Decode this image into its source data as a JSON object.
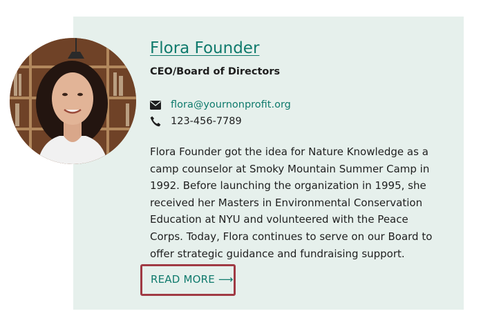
{
  "profile": {
    "name": "Flora Founder",
    "role": "CEO/Board of Directors",
    "email": "flora@yournonprofit.org",
    "phone": "123-456-7789",
    "bio_lines": [
      "Flora Founder got the idea for Nature Knowledge as a",
      "camp counselor at Smoky Mountain Summer Camp in",
      "1992. Before launching the organization in 1995, she",
      "received her Masters in Environmental Conservation",
      "Education at NYU and volunteered with the Peace",
      "Corps. Today, Flora continues to serve on our Board to",
      "offer strategic guidance and fundraising support."
    ],
    "read_more_label": "READ MORE",
    "read_more_arrow": "⟶"
  },
  "icons": {
    "email": "envelope-icon",
    "phone": "phone-icon"
  },
  "colors": {
    "card_background": "#e6f0ec",
    "link": "#0f7a6c",
    "highlight_border": "#a03a44",
    "text": "#1f1f1f"
  }
}
